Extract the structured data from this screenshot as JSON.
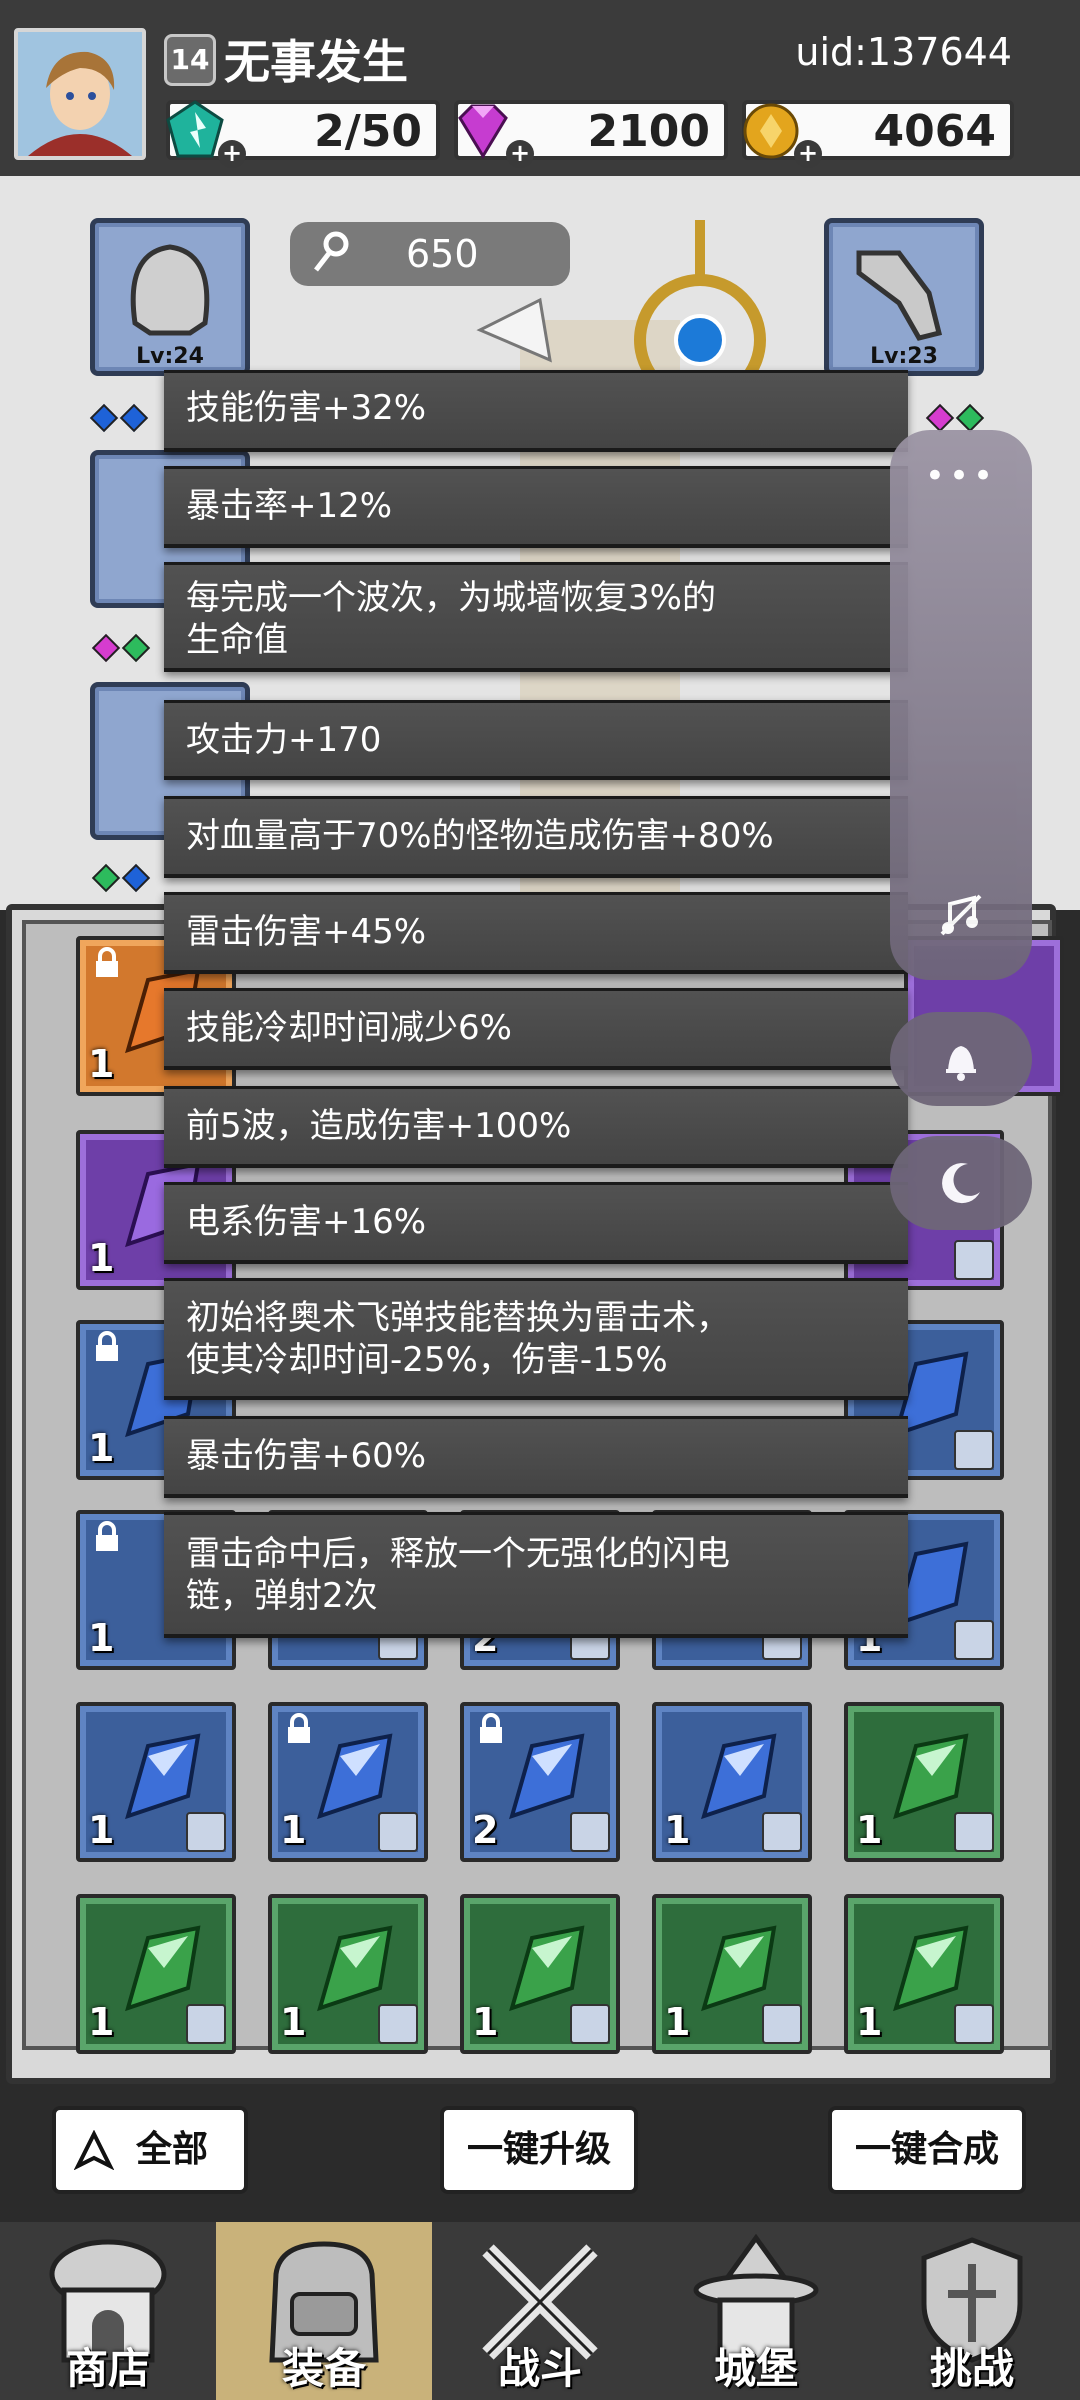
{
  "player": {
    "level": "14",
    "name": "无事发生",
    "uid": "uid:137644"
  },
  "resources": {
    "energy": "2/50",
    "gems": "2100",
    "coins": "4064",
    "plus": "+"
  },
  "hero": {
    "key_count": "650",
    "slot_top_left_level": "Lv:24",
    "slot_top_right_level": "Lv:23"
  },
  "stats": [
    "技能伤害+32%",
    "暴击率+12%",
    "每完成一个波次，为城墙恢复3%的\n生命值",
    "攻击力+170",
    "对血量高于70%的怪物造成伤害+80%",
    "雷击伤害+45%",
    "技能冷却时间减少6%",
    "前5波，造成伤害+100%",
    "电系伤害+16%",
    "初始将奥术飞弹技能替换为雷击术，\n使其冷却时间-25%，伤害-15%",
    "暴击伤害+60%",
    "雷击命中后，释放一个无强化的闪电\n链，弹射2次"
  ],
  "inventory": {
    "row_a": [
      "1",
      "1"
    ],
    "row_b": [
      "1"
    ],
    "row_c": [
      "1"
    ],
    "row_d": [
      "1",
      "1",
      "2",
      "1",
      "1"
    ],
    "row_e": [
      "1",
      "1",
      "2",
      "1",
      "1"
    ],
    "row_f": [
      "1",
      "1",
      "1",
      "1",
      "1"
    ]
  },
  "buttons": {
    "filter": "全部",
    "upgrade_all": "一键升级",
    "merge_all": "一键合成"
  },
  "nav": {
    "shop": "商店",
    "equipment": "装备",
    "battle": "战斗",
    "castle": "城堡",
    "challenge": "挑战"
  },
  "side_panel": {
    "menu": "•••"
  },
  "colors": {
    "rarity_blue": "#3c5f9b",
    "rarity_green": "#2e6d3c",
    "rarity_orange": "#d2782d",
    "rarity_purple": "#6e3fa8",
    "nav_active": "#c9b27a"
  }
}
